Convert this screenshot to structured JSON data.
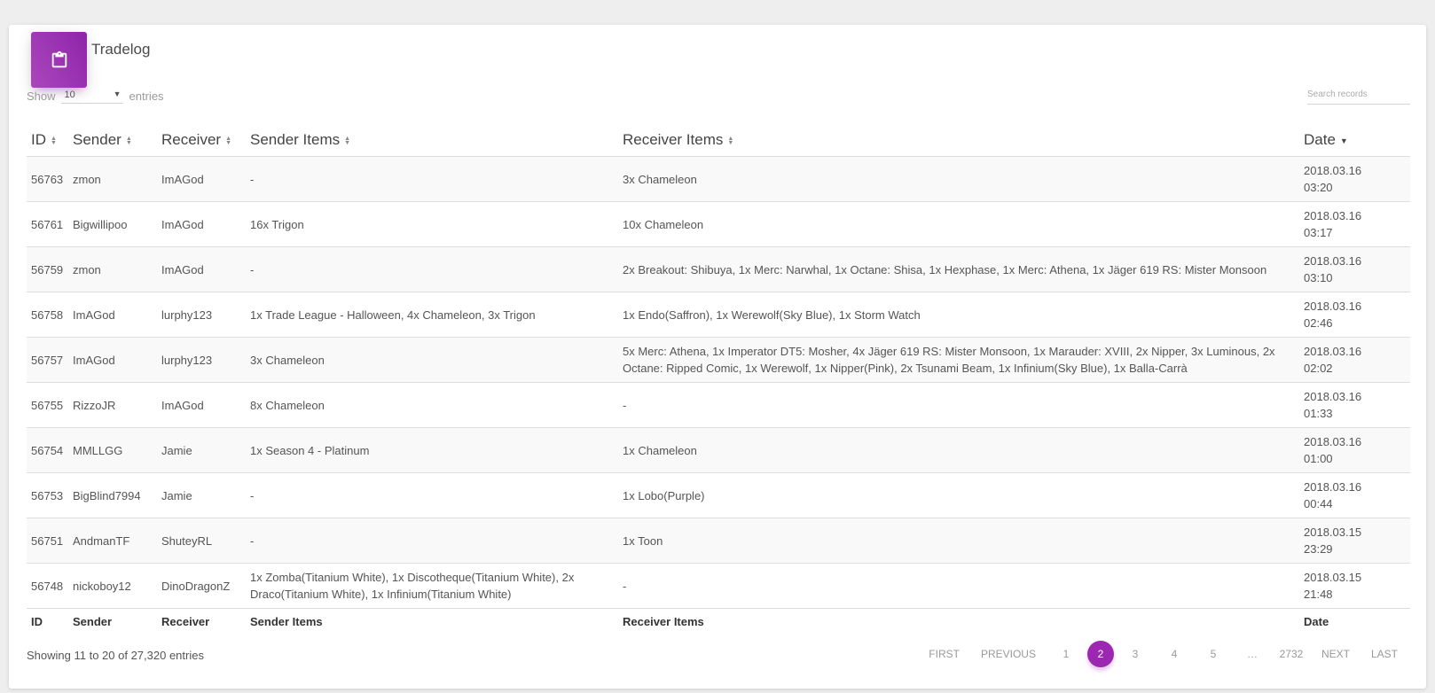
{
  "card": {
    "title": "Tradelog",
    "icon": "clipboard-icon",
    "accent": "#9c27b0"
  },
  "length": {
    "show_label": "Show",
    "value": "10",
    "entries_label": "entries"
  },
  "search": {
    "placeholder": "Search records",
    "value": ""
  },
  "columns": [
    "ID",
    "Sender",
    "Receiver",
    "Sender Items",
    "Receiver Items",
    "Date"
  ],
  "sort": {
    "column": "Date",
    "direction": "desc"
  },
  "rows": [
    {
      "id": "56763",
      "sender": "zmon",
      "receiver": "ImAGod",
      "sender_items": "-",
      "receiver_items": "3x Chameleon",
      "date": "2018.03.16 03:20"
    },
    {
      "id": "56761",
      "sender": "Bigwillipoo",
      "receiver": "ImAGod",
      "sender_items": "16x Trigon",
      "receiver_items": "10x Chameleon",
      "date": "2018.03.16 03:17"
    },
    {
      "id": "56759",
      "sender": "zmon",
      "receiver": "ImAGod",
      "sender_items": "-",
      "receiver_items": "2x Breakout: Shibuya, 1x Merc: Narwhal, 1x Octane: Shisa, 1x Hexphase, 1x Merc: Athena, 1x Jäger 619 RS: Mister Monsoon",
      "date": "2018.03.16 03:10"
    },
    {
      "id": "56758",
      "sender": "ImAGod",
      "receiver": "lurphy123",
      "sender_items": "1x Trade League - Halloween, 4x Chameleon, 3x Trigon",
      "receiver_items": "1x Endo(Saffron), 1x Werewolf(Sky Blue), 1x Storm Watch",
      "date": "2018.03.16 02:46"
    },
    {
      "id": "56757",
      "sender": "ImAGod",
      "receiver": "lurphy123",
      "sender_items": "3x Chameleon",
      "receiver_items": "5x Merc: Athena, 1x Imperator DT5: Mosher, 4x Jäger 619 RS: Mister Monsoon, 1x Marauder: XVIII, 2x Nipper, 3x Luminous, 2x Octane: Ripped Comic, 1x Werewolf, 1x Nipper(Pink), 2x Tsunami Beam, 1x Infinium(Sky Blue), 1x Balla-Carrà",
      "date": "2018.03.16 02:02"
    },
    {
      "id": "56755",
      "sender": "RizzoJR",
      "receiver": "ImAGod",
      "sender_items": "8x Chameleon",
      "receiver_items": "-",
      "date": "2018.03.16 01:33"
    },
    {
      "id": "56754",
      "sender": "MMLLGG",
      "receiver": "Jamie",
      "sender_items": "1x Season 4 - Platinum",
      "receiver_items": "1x Chameleon",
      "date": "2018.03.16 01:00"
    },
    {
      "id": "56753",
      "sender": "BigBlind7994",
      "receiver": "Jamie",
      "sender_items": "-",
      "receiver_items": "1x Lobo(Purple)",
      "date": "2018.03.16 00:44"
    },
    {
      "id": "56751",
      "sender": "AndmanTF",
      "receiver": "ShuteyRL",
      "sender_items": "-",
      "receiver_items": "1x Toon",
      "date": "2018.03.15 23:29"
    },
    {
      "id": "56748",
      "sender": "nickoboy12",
      "receiver": "DinoDragonZ",
      "sender_items": "1x Zomba(Titanium White), 1x Discotheque(Titanium White), 2x Draco(Titanium White), 1x Infinium(Titanium White)",
      "receiver_items": "-",
      "date": "2018.03.15 21:48"
    }
  ],
  "info": "Showing 11 to 20 of 27,320 entries",
  "pagination": {
    "first": "FIRST",
    "previous": "PREVIOUS",
    "pages": [
      "1",
      "2",
      "3",
      "4",
      "5",
      "…",
      "2732"
    ],
    "current": "2",
    "next": "NEXT",
    "last": "LAST"
  }
}
